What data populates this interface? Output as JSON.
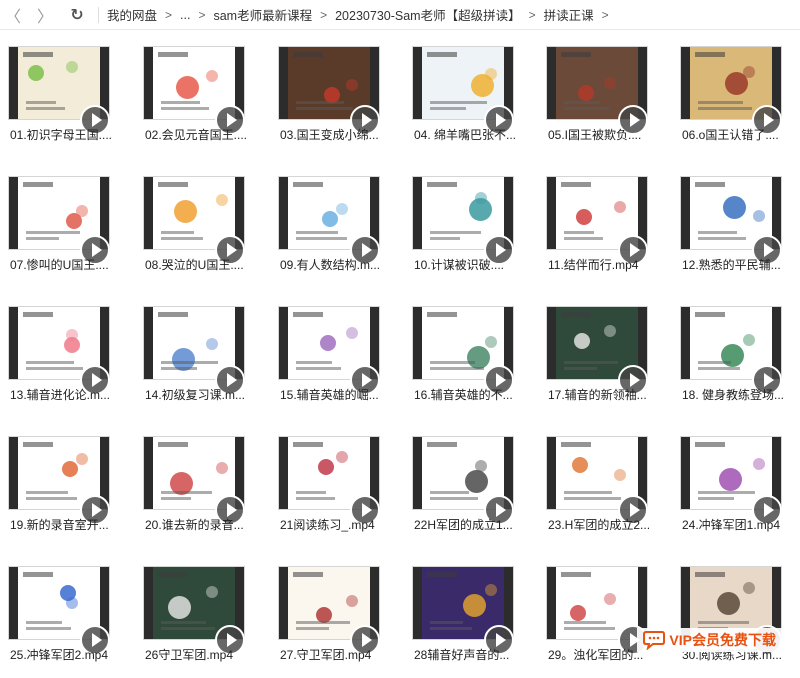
{
  "nav": {
    "back": "〈",
    "forward": "〉",
    "refresh": "↻"
  },
  "breadcrumb": [
    "我的网盘",
    "...",
    "sam老师最新课程",
    "20230730-Sam老师【超级拼读】",
    "拼读正课"
  ],
  "breadcrumb_sep": ">",
  "files": [
    {
      "name": "01.初识字母王国....",
      "bg": "#f2ecd8",
      "accent": "#7cbf4a"
    },
    {
      "name": "02.会见元音国王....",
      "bg": "#ffffff",
      "accent": "#e85a4a"
    },
    {
      "name": "03.国王变成小绵...",
      "bg": "#5a3b2a",
      "accent": "#c23a2a"
    },
    {
      "name": "04. 绵羊嘴巴张不...",
      "bg": "#eef3f7",
      "accent": "#f0b030"
    },
    {
      "name": "05.I国王被欺负....",
      "bg": "#6b4a3a",
      "accent": "#b03a2a"
    },
    {
      "name": "06.o国王认错了....",
      "bg": "#d9b878",
      "accent": "#9a3a2a"
    },
    {
      "name": "07.惨叫的U国王....",
      "bg": "#ffffff",
      "accent": "#e05a4a"
    },
    {
      "name": "08.哭泣的U国王....",
      "bg": "#ffffff",
      "accent": "#f0a030"
    },
    {
      "name": "09.有人数结构.m...",
      "bg": "#ffffff",
      "accent": "#6ab0e0"
    },
    {
      "name": "10.计谋被识破....",
      "bg": "#ffffff",
      "accent": "#3a9aa0"
    },
    {
      "name": "11.结伴而行.mp4",
      "bg": "#ffffff",
      "accent": "#d04040"
    },
    {
      "name": "12.熟悉的平民辅...",
      "bg": "#ffffff",
      "accent": "#3a70c0"
    },
    {
      "name": "13.辅音进化论.m...",
      "bg": "#ffffff",
      "accent": "#f07a8a"
    },
    {
      "name": "14.初级复习课.m...",
      "bg": "#ffffff",
      "accent": "#5a8ad0"
    },
    {
      "name": "15.辅音英雄的崛...",
      "bg": "#ffffff",
      "accent": "#a070c0"
    },
    {
      "name": "16.辅音英雄的不...",
      "bg": "#ffffff",
      "accent": "#4a8a6a"
    },
    {
      "name": "17.辅音的新领袖...",
      "bg": "#2f4a3a",
      "accent": "#e0e0e0"
    },
    {
      "name": "18. 健身教练登场...",
      "bg": "#ffffff",
      "accent": "#3a8a5a"
    },
    {
      "name": "19.新的录音室开...",
      "bg": "#ffffff",
      "accent": "#e06a3a"
    },
    {
      "name": "20.谁去新的录音...",
      "bg": "#ffffff",
      "accent": "#d04a4a"
    },
    {
      "name": "21阅读练习_.mp4",
      "bg": "#ffffff",
      "accent": "#c03a4a"
    },
    {
      "name": "22H军团的成立1...",
      "bg": "#ffffff",
      "accent": "#4a4a4a"
    },
    {
      "name": "23.H军团的成立2...",
      "bg": "#ffffff",
      "accent": "#e07a3a"
    },
    {
      "name": "24.冲锋军团1.mp4",
      "bg": "#ffffff",
      "accent": "#a050b0"
    },
    {
      "name": "25.冲锋军团2.mp4",
      "bg": "#ffffff",
      "accent": "#3a6ad0"
    },
    {
      "name": "26守卫军团.mp4",
      "bg": "#2f4a3a",
      "accent": "#e0e0e0"
    },
    {
      "name": "27.守卫军团.mp4",
      "bg": "#fbf7ee",
      "accent": "#b03a3a"
    },
    {
      "name": "28辅音好声音的...",
      "bg": "#3a2a6a",
      "accent": "#e0a030"
    },
    {
      "name": "29。浊化军团的...",
      "bg": "#ffffff",
      "accent": "#d04a4a"
    },
    {
      "name": "30.阅读练习课.m...",
      "bg": "#e8d8c8",
      "accent": "#5a4a3a"
    }
  ],
  "vip_badge": {
    "text": "VIP会员免费下载",
    "color": "#e8510f"
  }
}
